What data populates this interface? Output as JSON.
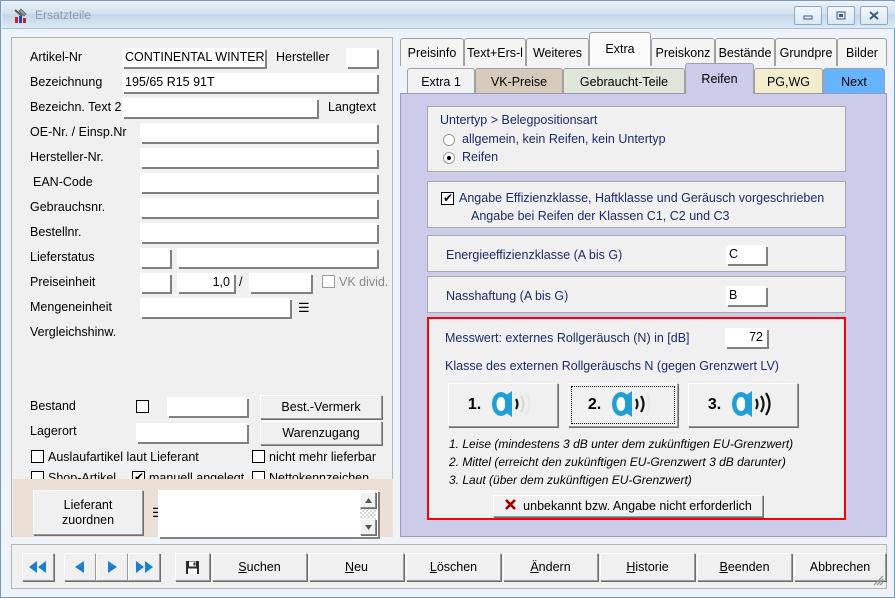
{
  "window": {
    "title": "Ersatzteile",
    "icon": "app-tools-icon",
    "controls": {
      "minimize": "minimize-icon",
      "restore": "restore-icon",
      "close": "close-icon"
    }
  },
  "form": {
    "fields": [
      {
        "label": "Artikel-Nr",
        "value": "CONTINENTAL WINTER"
      },
      {
        "label": "Bezeichnung",
        "value": "195/65 R15 91T"
      },
      {
        "label": "Bezeichn. Text 2",
        "value": ""
      },
      {
        "label": "OE-Nr. / Einsp.Nr",
        "value": ""
      },
      {
        "label": "Hersteller-Nr.",
        "value": ""
      },
      {
        "label": "EAN-Code",
        "value": ""
      },
      {
        "label": "Gebrauchsnr.",
        "value": ""
      },
      {
        "label": "Bestellnr.",
        "value": ""
      },
      {
        "label": "Lieferstatus",
        "value": ""
      },
      {
        "label": "Preiseinheit",
        "value": ""
      },
      {
        "label": "Mengeneinheit",
        "value": ""
      },
      {
        "label": "Vergleichshinw.",
        "value": ""
      }
    ],
    "hersteller_label": "Hersteller",
    "hersteller_value": "",
    "langtext_label": "Langtext",
    "preiseinheit": {
      "left_value": "",
      "qty_value": "1,0",
      "separator": "/",
      "right_value": "",
      "vk_divid_label": "VK divid.",
      "vk_divid_checked": false,
      "vk_divid_disabled": true
    },
    "mengeneinheit_menu_icon": "list-menu-icon",
    "bestand": {
      "label": "Bestand",
      "checked": false,
      "value": ""
    },
    "lagerort": {
      "label": "Lagerort",
      "value": ""
    },
    "buttons": {
      "best_vermerk": "Best.-Vermerk",
      "warenzugang": "Warenzugang"
    },
    "checkboxes": [
      {
        "label": "Auslaufartikel laut Lieferant",
        "checked": false
      },
      {
        "label": "nicht mehr lieferbar",
        "checked": false
      },
      {
        "label": "Shop-Artikel",
        "checked": false
      },
      {
        "label": "manuell angelegt",
        "checked": true
      },
      {
        "label": "Nettokennzeichen",
        "checked": false
      }
    ],
    "supplier": {
      "button_line1": "Lieferant",
      "button_line2": "zuordnen",
      "menu_icon": "list-menu-icon",
      "list_value": "",
      "scroll_up_icon": "triangle-up-icon",
      "scroll_down_icon": "triangle-down-icon"
    }
  },
  "tabs_primary": {
    "active": "Extra",
    "items": [
      {
        "label": "Preisinfo"
      },
      {
        "label": "Text+Ers-l"
      },
      {
        "label": "Weiteres"
      },
      {
        "label": "Extra"
      },
      {
        "label": "Preiskonz"
      },
      {
        "label": "Bestände"
      },
      {
        "label": "Grundpre"
      },
      {
        "label": "Bilder"
      }
    ]
  },
  "tabs_secondary": {
    "active": "Reifen",
    "items": [
      {
        "label": "Extra 1",
        "color": "#f2f2f2"
      },
      {
        "label": "VK-Preise",
        "color": "#d6cbbb"
      },
      {
        "label": "Gebraucht-Teile",
        "color": "#dfe6da"
      },
      {
        "label": "Reifen",
        "color": "#ccccea"
      },
      {
        "label": "PG,WG",
        "color": "#f2eecd"
      },
      {
        "label": "Next",
        "color": "#66b3ff"
      }
    ]
  },
  "tire_panel": {
    "untertyp": {
      "title": "Untertyp > Belegpositionsart",
      "options": [
        {
          "label": "allgemein, kein Reifen, kein Untertyp",
          "selected": false
        },
        {
          "label": "Reifen",
          "selected": true
        }
      ]
    },
    "mandatory": {
      "checked": true,
      "line1": "Angabe Effizienzklasse, Haftklasse und Geräusch vorgeschrieben",
      "line2": "Angabe bei Reifen der Klassen C1, C2 und C3"
    },
    "energy": {
      "label": "Energieeffizienzklasse (A bis G)",
      "value": "C"
    },
    "wet": {
      "label": "Nasshaftung (A bis G)",
      "value": "B"
    },
    "noise": {
      "measure_label": "Messwert: externes Rollgeräusch (N) in [dB]",
      "measure_value": "72",
      "class_label": "Klasse des externen Rollgeräuschs N (gegen Grenzwert LV)",
      "buttons": [
        {
          "number": "1.",
          "waves": 1,
          "selected": false,
          "icon": "tire-noise-icon"
        },
        {
          "number": "2.",
          "waves": 2,
          "selected": true,
          "icon": "tire-noise-icon"
        },
        {
          "number": "3.",
          "waves": 3,
          "selected": false,
          "icon": "tire-noise-icon"
        }
      ],
      "legend": [
        "1. Leise (mindestens 3 dB unter dem zukünftigen EU-Grenzwert)",
        "2. Mittel (erreicht den zukünftigen EU-Grenzwert 3 dB darunter)",
        "3. Laut (über dem zukünftigen EU-Grenzwert)"
      ],
      "unknown_button": {
        "icon": "red-x-icon",
        "label": "unbekannt bzw. Angabe nicht erforderlich"
      },
      "border_color": "#ff0000"
    }
  },
  "toolbar": {
    "nav": [
      {
        "name": "first",
        "icon": "double-arrow-left-icon"
      },
      {
        "name": "prev",
        "icon": "arrow-left-icon"
      },
      {
        "name": "next",
        "icon": "arrow-right-icon"
      },
      {
        "name": "last",
        "icon": "double-arrow-right-icon"
      }
    ],
    "save_icon": "floppy-disk-icon",
    "buttons": [
      {
        "label": "Suchen",
        "accel": "S"
      },
      {
        "label": "Neu",
        "accel": "N"
      },
      {
        "label": "Löschen",
        "accel": "L"
      },
      {
        "label": "Ändern",
        "accel": "Ä"
      },
      {
        "label": "Historie",
        "accel": "H"
      },
      {
        "label": "Beenden",
        "accel": "B"
      },
      {
        "label": "Abbrechen",
        "accel": ""
      }
    ],
    "resize_grip": "resize-grip-icon"
  }
}
